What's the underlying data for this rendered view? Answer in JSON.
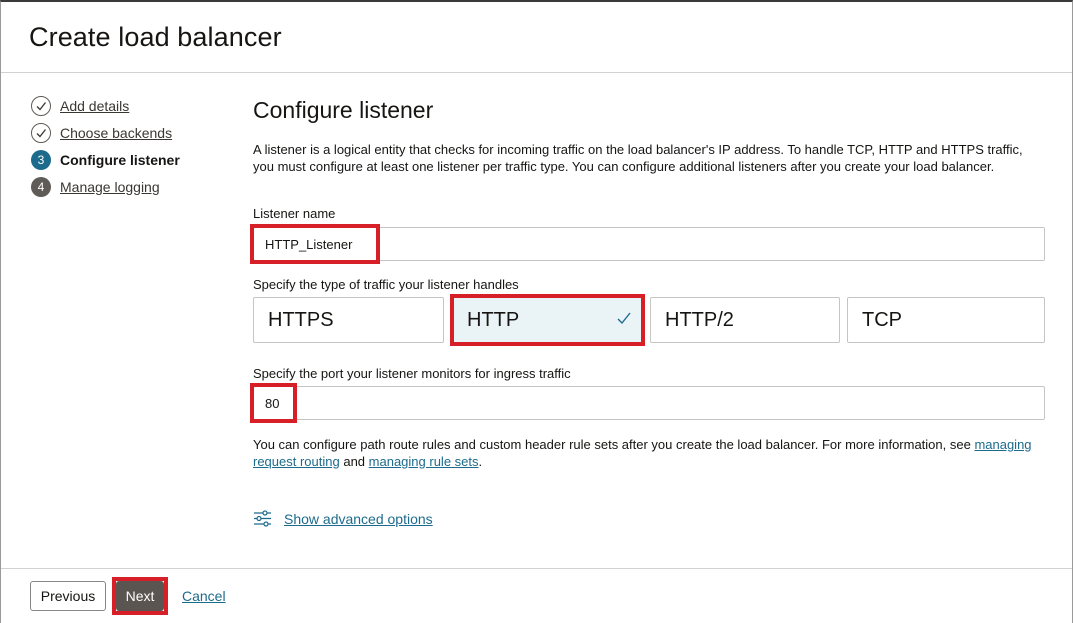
{
  "header": {
    "title": "Create load balancer"
  },
  "steps": [
    {
      "number": "",
      "label": "Add details",
      "state": "done"
    },
    {
      "number": "",
      "label": "Choose backends",
      "state": "done"
    },
    {
      "number": "3",
      "label": "Configure listener",
      "state": "current"
    },
    {
      "number": "4",
      "label": "Manage logging",
      "state": "todo"
    }
  ],
  "main": {
    "title": "Configure listener",
    "description": "A listener is a logical entity that checks for incoming traffic on the load balancer's IP address. To handle TCP, HTTP and HTTPS traffic, you must configure at least one listener per traffic type. You can configure additional listeners after you create your load balancer.",
    "listener_name": {
      "label": "Listener name",
      "value": "HTTP_Listener"
    },
    "traffic": {
      "label": "Specify the type of traffic your listener handles",
      "options": [
        "HTTPS",
        "HTTP",
        "HTTP/2",
        "TCP"
      ],
      "selected": "HTTP"
    },
    "port": {
      "label": "Specify the port your listener monitors for ingress traffic",
      "value": "80"
    },
    "info": {
      "text_before": "You can configure path route rules and custom header rule sets after you create the load balancer. For more information, see ",
      "link1": "managing request routing",
      "text_middle": " and ",
      "link2": "managing rule sets",
      "text_after": "."
    },
    "advanced_link": "Show advanced options"
  },
  "footer": {
    "previous_label": "Previous",
    "next_label": "Next",
    "cancel_label": "Cancel"
  },
  "colors": {
    "accent": "#1d6b8c",
    "highlight": "#d71f27",
    "primary_button": "#5a5550",
    "selected_tile": "#eaf3f6"
  }
}
